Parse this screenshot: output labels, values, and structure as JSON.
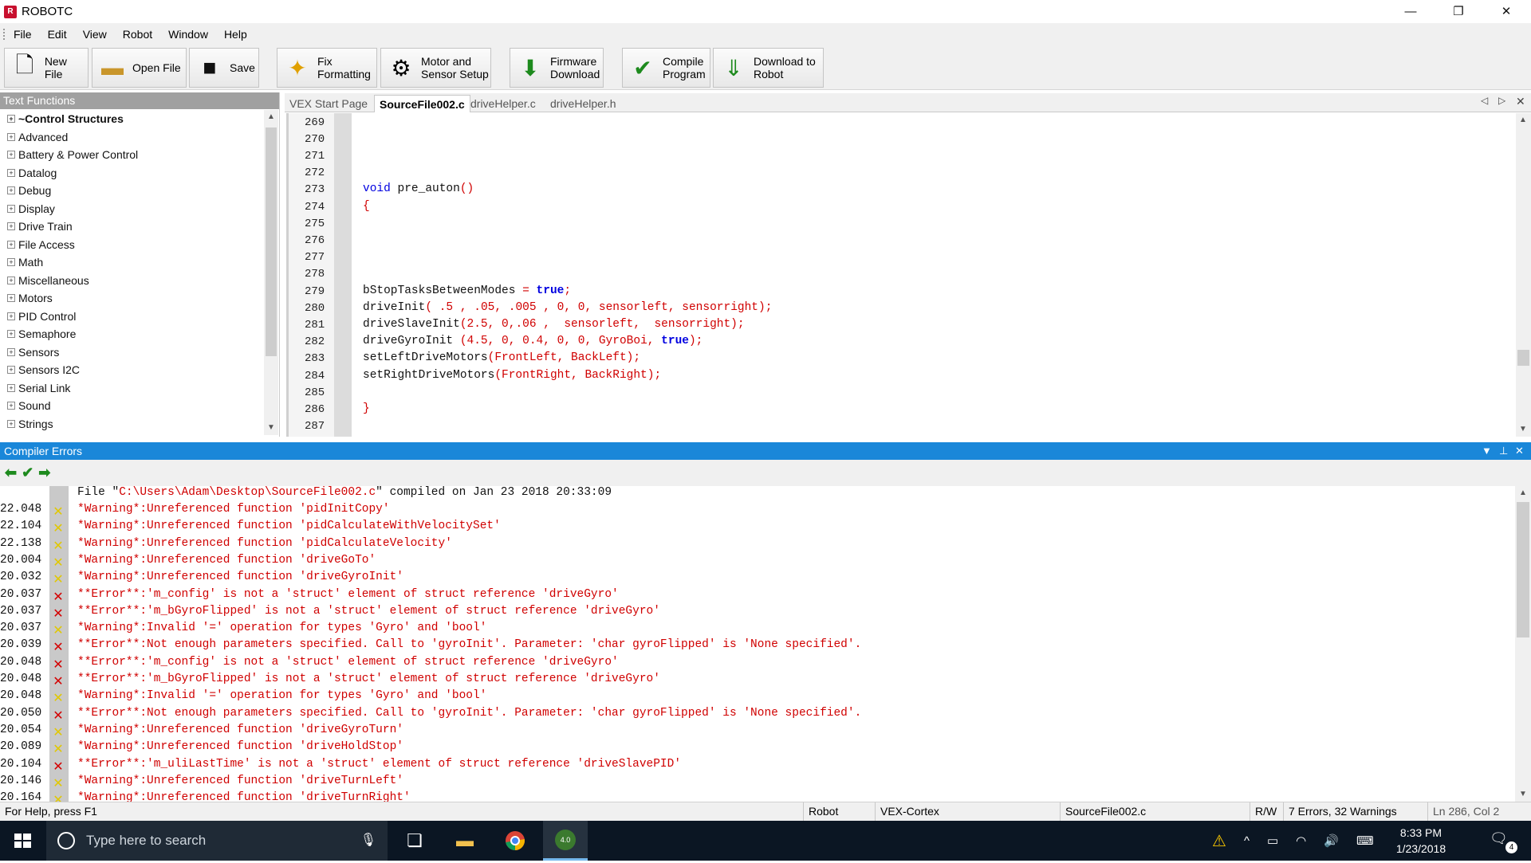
{
  "window": {
    "title": "ROBOTC",
    "logo_text": "R"
  },
  "menu": [
    "File",
    "Edit",
    "View",
    "Robot",
    "Window",
    "Help"
  ],
  "toolbar": {
    "new_file": "New File",
    "open_file": "Open File",
    "save": "Save",
    "fix_formatting": "Fix\nFormatting",
    "motor_sensor": "Motor and\nSensor Setup",
    "firmware": "Firmware\nDownload",
    "compile": "Compile\nProgram",
    "download": "Download to\nRobot"
  },
  "text_functions": {
    "header": "Text Functions",
    "items": [
      "~Control Structures",
      "Advanced",
      "Battery & Power Control",
      "Datalog",
      "Debug",
      "Display",
      "Drive Train",
      "File Access",
      "Math",
      "Miscellaneous",
      "Motors",
      "PID Control",
      "Semaphore",
      "Sensors",
      "Sensors I2C",
      "Serial Link",
      "Sound",
      "Strings"
    ]
  },
  "editor": {
    "tabs": [
      "VEX Start Page",
      "SourceFile002.c",
      "driveHelper.c",
      "driveHelper.h"
    ],
    "active_tab": "SourceFile002.c",
    "line_numbers": [
      "269",
      "270",
      "271",
      "272",
      "273",
      "274",
      "275",
      "276",
      "277",
      "278",
      "279",
      "280",
      "281",
      "282",
      "283",
      "284",
      "285",
      "286",
      "287"
    ]
  },
  "compiler_errors": {
    "header": "Compiler Errors",
    "file_line": {
      "prefix": "File \"",
      "path": "C:\\Users\\Adam\\Desktop\\SourceFile002.c",
      "suffix": "\" compiled on Jan 23 2018 20:33:09"
    },
    "rows": [
      {
        "time": "22.048",
        "type": "warning",
        "label": "*Warning*",
        "text": ":Unreferenced function 'pidInitCopy'"
      },
      {
        "time": "22.104",
        "type": "warning",
        "label": "*Warning*",
        "text": ":Unreferenced function 'pidCalculateWithVelocitySet'"
      },
      {
        "time": "22.138",
        "type": "warning",
        "label": "*Warning*",
        "text": ":Unreferenced function 'pidCalculateVelocity'"
      },
      {
        "time": "20.004",
        "type": "warning",
        "label": "*Warning*",
        "text": ":Unreferenced function 'driveGoTo'"
      },
      {
        "time": "20.032",
        "type": "warning",
        "label": "*Warning*",
        "text": ":Unreferenced function 'driveGyroInit'"
      },
      {
        "time": "20.037",
        "type": "error",
        "label": "**Error**",
        "text": ":'m_config' is not a 'struct' element of struct reference 'driveGyro'"
      },
      {
        "time": "20.037",
        "type": "error",
        "label": "**Error**",
        "text": ":'m_bGyroFlipped' is not a 'struct' element of struct reference 'driveGyro'"
      },
      {
        "time": "20.037",
        "type": "warning",
        "label": "*Warning*",
        "text": ":Invalid '=' operation for types 'Gyro' and 'bool'"
      },
      {
        "time": "20.039",
        "type": "error",
        "label": "**Error**",
        "text": ":Not enough parameters specified. Call to 'gyroInit'. Parameter: 'char gyroFlipped' is 'None specified'."
      },
      {
        "time": "20.048",
        "type": "error",
        "label": "**Error**",
        "text": ":'m_config' is not a 'struct' element of struct reference 'driveGyro'"
      },
      {
        "time": "20.048",
        "type": "error",
        "label": "**Error**",
        "text": ":'m_bGyroFlipped' is not a 'struct' element of struct reference 'driveGyro'"
      },
      {
        "time": "20.048",
        "type": "warning",
        "label": "*Warning*",
        "text": ":Invalid '=' operation for types 'Gyro' and 'bool'"
      },
      {
        "time": "20.050",
        "type": "error",
        "label": "**Error**",
        "text": ":Not enough parameters specified. Call to 'gyroInit'. Parameter: 'char gyroFlipped' is 'None specified'."
      },
      {
        "time": "20.054",
        "type": "warning",
        "label": "*Warning*",
        "text": ":Unreferenced function 'driveGyroTurn'"
      },
      {
        "time": "20.089",
        "type": "warning",
        "label": "*Warning*",
        "text": ":Unreferenced function 'driveHoldStop'"
      },
      {
        "time": "20.104",
        "type": "error",
        "label": "**Error**",
        "text": ":'m_uliLastTime' is not a 'struct' element of struct reference 'driveSlavePID'"
      },
      {
        "time": "20.146",
        "type": "warning",
        "label": "*Warning*",
        "text": ":Unreferenced function 'driveTurnLeft'"
      },
      {
        "time": "20.164",
        "type": "warning",
        "label": "*Warning*",
        "text": ":Unreferenced function 'driveTurnRight'"
      }
    ]
  },
  "statusbar": {
    "help": "For Help, press F1",
    "robot": "Robot",
    "platform": "VEX-Cortex",
    "file": "SourceFile002.c",
    "rw": "R/W",
    "summary": "7 Errors, 32 Warnings",
    "position": "Ln 286, Col 2"
  },
  "taskbar": {
    "search_placeholder": "Type here to search",
    "time": "8:33 PM",
    "date": "1/23/2018",
    "notification_count": "4",
    "robotc_badge": "4.0"
  },
  "colors": {
    "accent": "#1a87d9",
    "error": "#d00000",
    "keyword": "#0000e0",
    "warning_icon": "#e1c800"
  }
}
